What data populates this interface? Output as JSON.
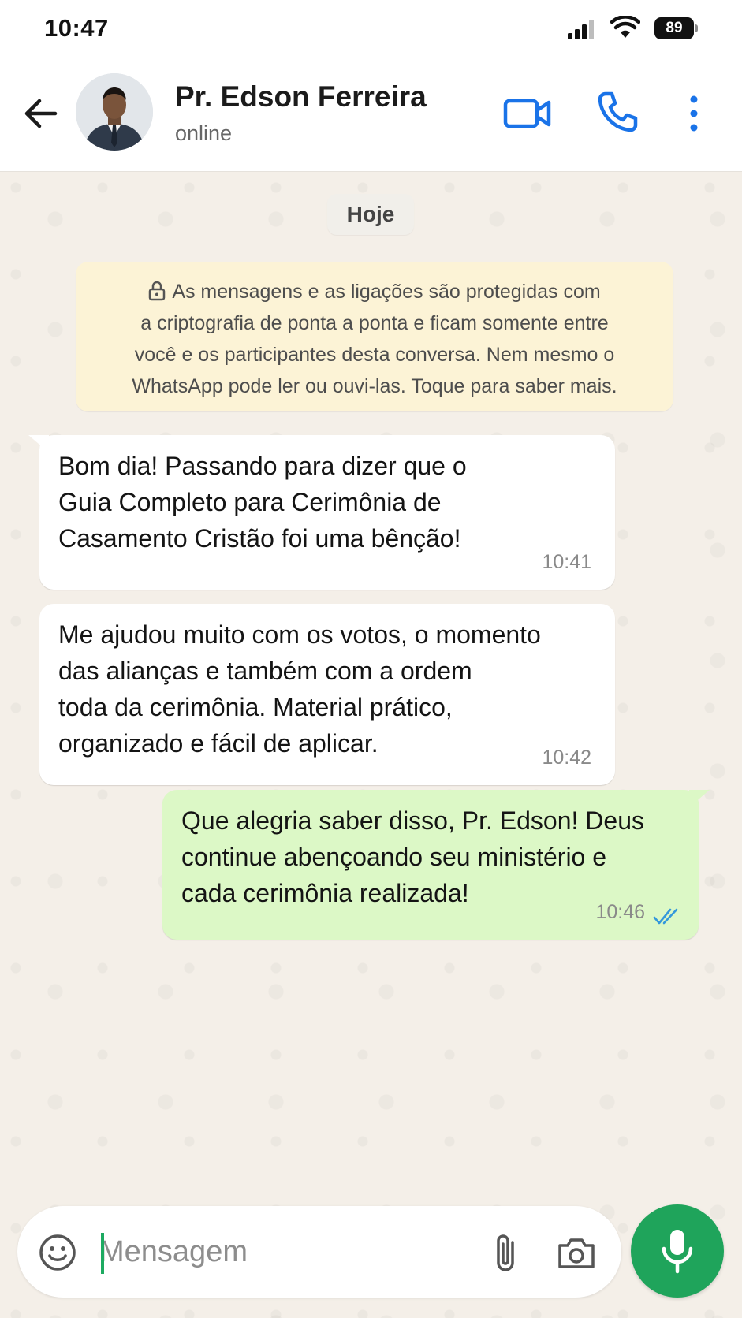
{
  "status_bar": {
    "time": "10:47",
    "battery_level": "89",
    "icons": [
      "signal-icon",
      "wifi-icon",
      "battery-icon"
    ]
  },
  "header": {
    "contact_name": "Pr. Edson Ferreira",
    "contact_status": "online",
    "icons": [
      "back-arrow-icon",
      "avatar",
      "video-call-icon",
      "voice-call-icon",
      "more-options-icon"
    ]
  },
  "chat": {
    "date_chip": "Hoje",
    "encryption_notice": "As mensagens e as ligações são protegidas com\na criptografia de ponta a ponta e ficam somente entre\nvocê e os participantes desta conversa. Nem mesmo o\nWhatsApp pode ler ou ouvi-las. Toque para saber mais.",
    "messages": [
      {
        "direction": "incoming",
        "text": "Bom dia! Passando para dizer que o\nGuia Completo para Cerimônia de\nCasamento Cristão foi uma bênção!",
        "time": "10:41"
      },
      {
        "direction": "incoming",
        "text": "Me ajudou muito com os votos, o momento\ndas alianças e também com a ordem\ntoda da cerimônia. Material prático,\norganizado e fácil de aplicar.",
        "time": "10:42"
      },
      {
        "direction": "outgoing",
        "text": "Que alegria saber disso, Pr. Edson! Deus\ncontinue abençoando seu ministério e\ncada cerimônia realizada!",
        "time": "10:46",
        "read_status": "read"
      }
    ]
  },
  "composer": {
    "placeholder": "Mensagem",
    "value": "",
    "icons": [
      "emoji-icon",
      "attach-icon",
      "camera-icon",
      "mic-icon"
    ]
  },
  "colors": {
    "accent_green": "#1fa45b",
    "outgoing_bubble": "#dcf8c6",
    "incoming_bubble": "#ffffff",
    "notice_bg": "#fcf3d6",
    "chat_bg": "#f4efe8",
    "icon_blue": "#1a73e8",
    "read_tick": "#3498db"
  }
}
